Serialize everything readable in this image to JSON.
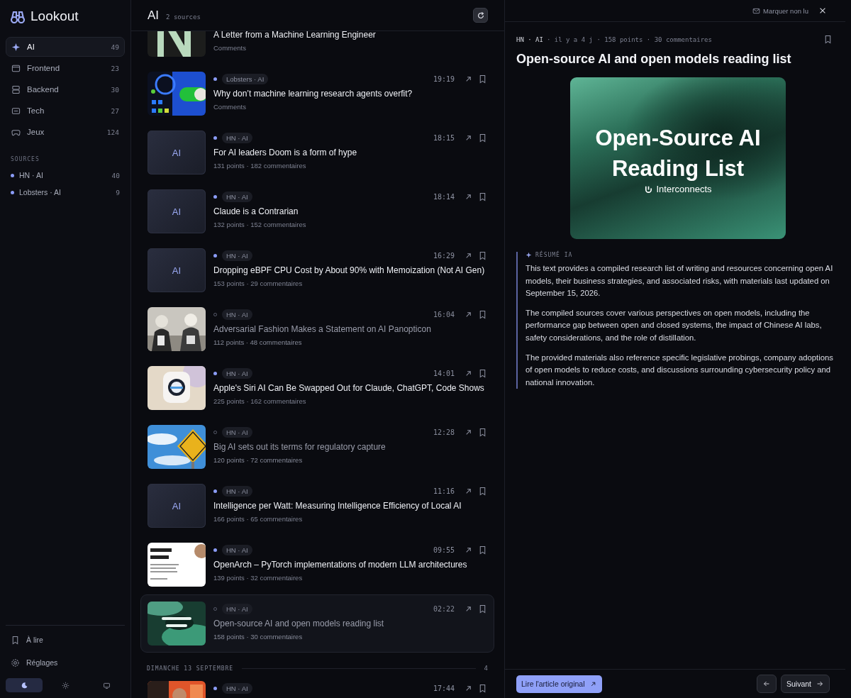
{
  "app": {
    "name": "Lookout"
  },
  "sidebar": {
    "items": [
      {
        "label": "AI",
        "count": "49",
        "selected": true
      },
      {
        "label": "Frontend",
        "count": "23",
        "selected": false
      },
      {
        "label": "Backend",
        "count": "30",
        "selected": false
      },
      {
        "label": "Tech",
        "count": "27",
        "selected": false
      },
      {
        "label": "Jeux",
        "count": "124",
        "selected": false
      }
    ],
    "sources_heading": "SOURCES",
    "sources": [
      {
        "label": "HN · AI",
        "count": "40",
        "color": "#8b9cf7"
      },
      {
        "label": "Lobsters · AI",
        "count": "9",
        "color": "#8b9cf7"
      }
    ],
    "footer_items": [
      {
        "label": "À lire"
      },
      {
        "label": "Réglages"
      }
    ],
    "theme_options": [
      {
        "selected": true
      },
      {
        "selected": false
      },
      {
        "selected": false
      }
    ]
  },
  "feed": {
    "title": "AI",
    "subtitle": "2 sources",
    "items": [
      {
        "title": "A Letter from a Machine Learning Engineer",
        "meta": "Comments",
        "read": false,
        "selected": false
      },
      {
        "source": "Lobsters · AI",
        "time": "19:19",
        "title": "Why don’t machine learning research agents overfit?",
        "meta": "Comments",
        "read": false,
        "selected": false
      },
      {
        "source": "HN · AI",
        "time": "18:15",
        "title": "For AI leaders Doom is a form of hype",
        "meta": "131 points · 182 commentaires",
        "thumb": {
          "kind": "placeholder",
          "text": "AI"
        },
        "read": false,
        "selected": false
      },
      {
        "source": "HN · AI",
        "time": "18:14",
        "title": "Claude is a Contrarian",
        "meta": "132 points · 152 commentaires",
        "thumb": {
          "kind": "placeholder",
          "text": "AI"
        },
        "read": false,
        "selected": false
      },
      {
        "source": "HN · AI",
        "time": "16:29",
        "title": "Dropping eBPF CPU Cost by About 90% with Memoization (Not AI Gen)",
        "meta": "153 points · 29 commentaires",
        "thumb": {
          "kind": "placeholder",
          "text": "AI"
        },
        "read": false,
        "selected": false
      },
      {
        "source": "HN · AI",
        "time": "16:04",
        "title": "Adversarial Fashion Makes a Statement on AI Panopticon",
        "meta": "112 points · 48 commentaires",
        "read": true,
        "selected": false
      },
      {
        "source": "HN · AI",
        "time": "14:01",
        "title": "Apple's Siri AI Can Be Swapped Out for Claude, ChatGPT, Code Shows",
        "meta": "225 points · 162 commentaires",
        "read": false,
        "selected": false
      },
      {
        "source": "HN · AI",
        "time": "12:28",
        "title": "Big AI sets out its terms for regulatory capture",
        "meta": "120 points · 72 commentaires",
        "read": true,
        "selected": false
      },
      {
        "source": "HN · AI",
        "time": "11:16",
        "title": "Intelligence per Watt: Measuring Intelligence Efficiency of Local AI",
        "meta": "166 points · 65 commentaires",
        "thumb": {
          "kind": "placeholder",
          "text": "AI"
        },
        "read": false,
        "selected": false
      },
      {
        "source": "HN · AI",
        "time": "09:55",
        "title": "OpenArch – PyTorch implementations of modern LLM architectures",
        "meta": "139 points · 32 commentaires",
        "read": false,
        "selected": false
      },
      {
        "source": "HN · AI",
        "time": "02:22",
        "title": "Open-source AI and open models reading list",
        "meta": "158 points · 30 commentaires",
        "read": true,
        "selected": true
      }
    ],
    "section": {
      "label": "DIMANCHE 13 SEPTEMBRE",
      "count": "4"
    },
    "section_items": [
      {
        "source": "HN · AI",
        "time": "17:44",
        "read": false,
        "selected": false
      }
    ]
  },
  "reader": {
    "mark_unread": "Marquer non lu",
    "source": "HN · AI",
    "meta": "· il y a 4 j · 158 points · 30 commentaires",
    "title": "Open-source AI and open models reading list",
    "hero": {
      "title": "Open-Source AI Reading List",
      "brand": "Interconnects"
    },
    "summary_label": "RÉSUMÉ IA",
    "summary": [
      "This text provides a compiled research list of writing and resources concerning open AI models, their business strategies, and associated risks, with materials last updated on September 15, 2026.",
      "The compiled sources cover various perspectives on open models, including the performance gap between open and closed systems, the impact of Chinese AI labs, safety considerations, and the role of distillation.",
      "The provided materials also reference specific legislative probings, company adoptions of open models to reduce costs, and discussions surrounding cybersecurity policy and national innovation."
    ],
    "open_original": "Lire l'article original",
    "next": "Suivant"
  }
}
